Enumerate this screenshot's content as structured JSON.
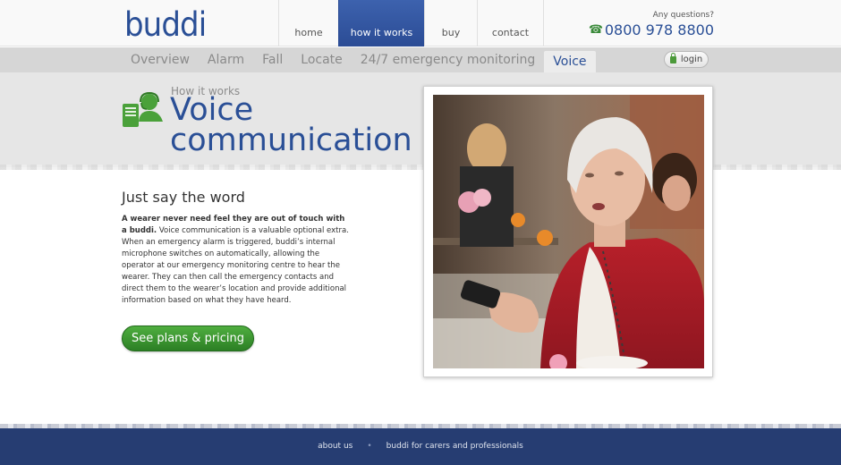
{
  "header": {
    "logo": "buddi",
    "nav": [
      {
        "label": "home",
        "active": false
      },
      {
        "label": "how it works",
        "active": true
      },
      {
        "label": "buy",
        "active": false
      },
      {
        "label": "contact",
        "active": false
      }
    ],
    "questions": "Any questions?",
    "phone": "0800 978 8800",
    "phone_icon": "phone-icon"
  },
  "subnav": {
    "items": [
      "Overview",
      "Alarm",
      "Fall",
      "Locate",
      "24/7 emergency monitoring",
      "Voice"
    ],
    "active": "Voice",
    "login": "login"
  },
  "hero": {
    "kicker": "How it works",
    "title": "Voice communication",
    "icon": "headset-operator-icon"
  },
  "content": {
    "heading": "Just say the word",
    "lead": "A wearer never need feel they are out of touch with a buddi.",
    "body": " Voice communication is a valuable optional extra. When an emergency alarm is triggered, buddi’s internal microphone switches on automatically, allowing the operator at our emergency monitoring centre to hear the wearer. They can then call the emergency contacts and direct them to the wearer’s location and provide additional information based on what they have heard.",
    "cta": "See plans & pricing"
  },
  "footer": {
    "links": [
      "about us",
      "buddi for carers and professionals"
    ],
    "separator": "•"
  },
  "colors": {
    "brand_blue": "#2a4f96",
    "nav_active": "#3d62ae",
    "cta_green": "#3a9a30",
    "footer_bg": "#263d72"
  }
}
